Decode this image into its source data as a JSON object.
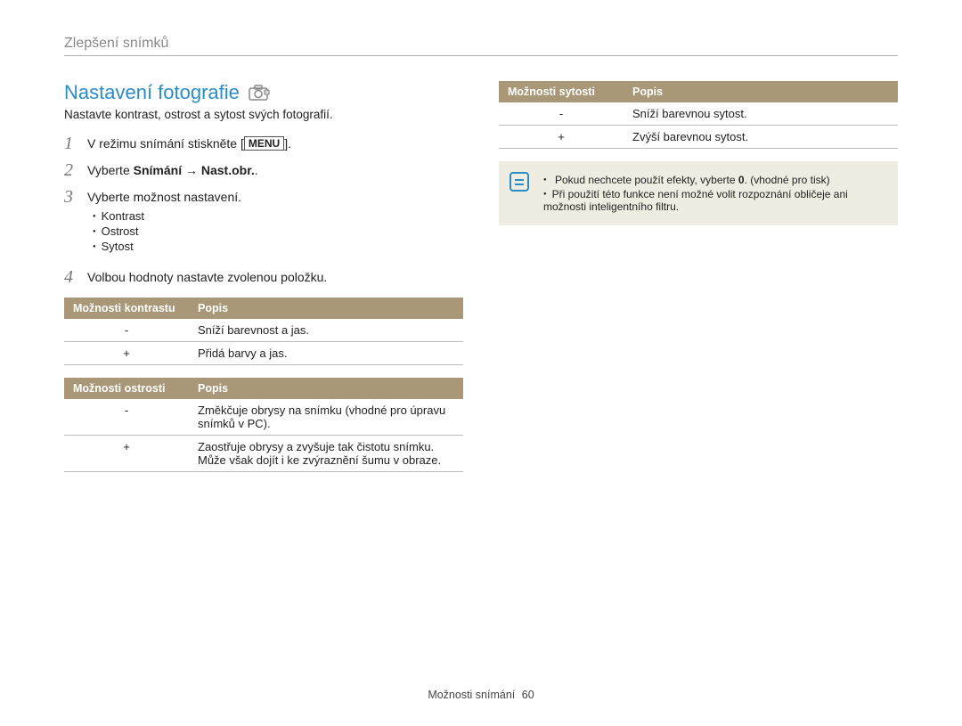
{
  "breadcrumb": "Zlepšení snímků",
  "heading": "Nastavení fotografie",
  "intro": "Nastavte kontrast, ostrost a sytost svých fotografií.",
  "steps": {
    "s1_pre": "V režimu snímání stiskněte [",
    "s1_btn": "MENU",
    "s1_post": "].",
    "s2_pre": "Vyberte ",
    "s2_bold": "Snímání → Nast.obr.",
    "s2_post": ".",
    "s3": "Vyberte možnost nastavení.",
    "s3_items": {
      "a": "Kontrast",
      "b": "Ostrost",
      "c": "Sytost"
    },
    "s4": "Volbou hodnoty nastavte zvolenou položku."
  },
  "table_contrast": {
    "h1": "Možnosti kontrastu",
    "h2": "Popis",
    "rows": [
      {
        "k": "-",
        "v": "Sníží barevnost a jas."
      },
      {
        "k": "+",
        "v": "Přidá barvy a jas."
      }
    ]
  },
  "table_sharpness": {
    "h1": "Možnosti ostrosti",
    "h2": "Popis",
    "rows": [
      {
        "k": "-",
        "v": "Změkčuje obrysy na snímku (vhodné pro úpravu snímků v PC)."
      },
      {
        "k": "+",
        "v": "Zaostřuje obrysy a zvyšuje tak čistotu snímku. Může však dojít i ke zvýraznění šumu v obraze."
      }
    ]
  },
  "table_saturation": {
    "h1": "Možnosti sytosti",
    "h2": "Popis",
    "rows": [
      {
        "k": "-",
        "v": "Sníží barevnou sytost."
      },
      {
        "k": "+",
        "v": "Zvýší barevnou sytost."
      }
    ]
  },
  "note": {
    "n1_pre": "Pokud nechcete použít efekty, vyberte ",
    "n1_bold": "0",
    "n1_post": ". (vhodné pro tisk)",
    "n2": "Při použití této funkce není možné volit rozpoznání obličeje ani možnosti inteligentního filtru."
  },
  "footer_label": "Možnosti snímání",
  "footer_page": "60"
}
